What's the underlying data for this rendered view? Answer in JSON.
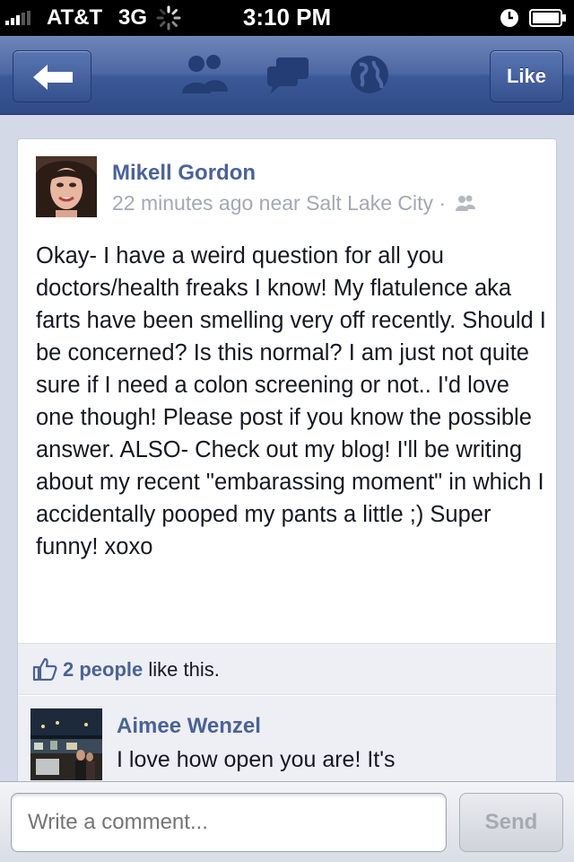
{
  "status_bar": {
    "carrier": "AT&T",
    "network": "3G",
    "time": "3:10 PM"
  },
  "nav": {
    "like_label": "Like",
    "icons": [
      "back-arrow-icon",
      "friends-icon",
      "messages-icon",
      "globe-notifications-icon"
    ]
  },
  "post": {
    "author": "Mikell Gordon",
    "meta": "22 minutes ago near Salt Lake City ·",
    "privacy_icon": "friends-mini-icon",
    "body": "Okay- I have a weird question for all you doctors/health freaks I know! My flatulence aka farts have been smelling very off recently. Should I be concerned? Is this normal? I am just not quite sure if I need a colon screening or not.. I'd love one though! Please post if you know the possible answer. ALSO- Check out my blog! I'll be writing about my recent \"embarassing moment\" in which I accidentally pooped my pants a little ;) Super funny! xoxo",
    "likes_count_text": "2 people",
    "likes_suffix": " like this."
  },
  "comment": {
    "author": "Aimee Wenzel",
    "text": "I love how open you are! It's"
  },
  "composer": {
    "placeholder": "Write a comment...",
    "send_label": "Send"
  },
  "colors": {
    "navbar": "#3b5998",
    "link": "#4b6296",
    "background": "#d3d9e6"
  }
}
